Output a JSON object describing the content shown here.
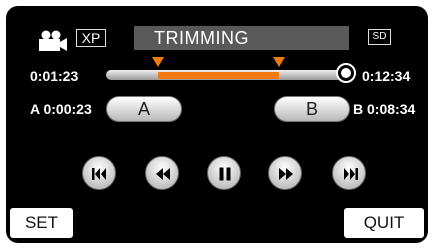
{
  "header": {
    "mode_icon": "video-camera-icon",
    "quality_badge": "XP",
    "title": "TRIMMING",
    "media_badge": "SD"
  },
  "timeline": {
    "start_time": "0:01:23",
    "end_time": "0:12:34",
    "colors": {
      "range": "#f07a10",
      "track": "#c8c8c8"
    }
  },
  "points": {
    "a_label": "A",
    "a_time": "0:00:23",
    "a_button": "A",
    "b_label": "B",
    "b_time": "0:08:34",
    "b_button": "B"
  },
  "controls": {
    "icons": [
      "skip-back-icon",
      "rewind-icon",
      "pause-icon",
      "fast-forward-icon",
      "skip-forward-icon"
    ]
  },
  "footer": {
    "set_label": "SET",
    "quit_label": "QUIT"
  }
}
